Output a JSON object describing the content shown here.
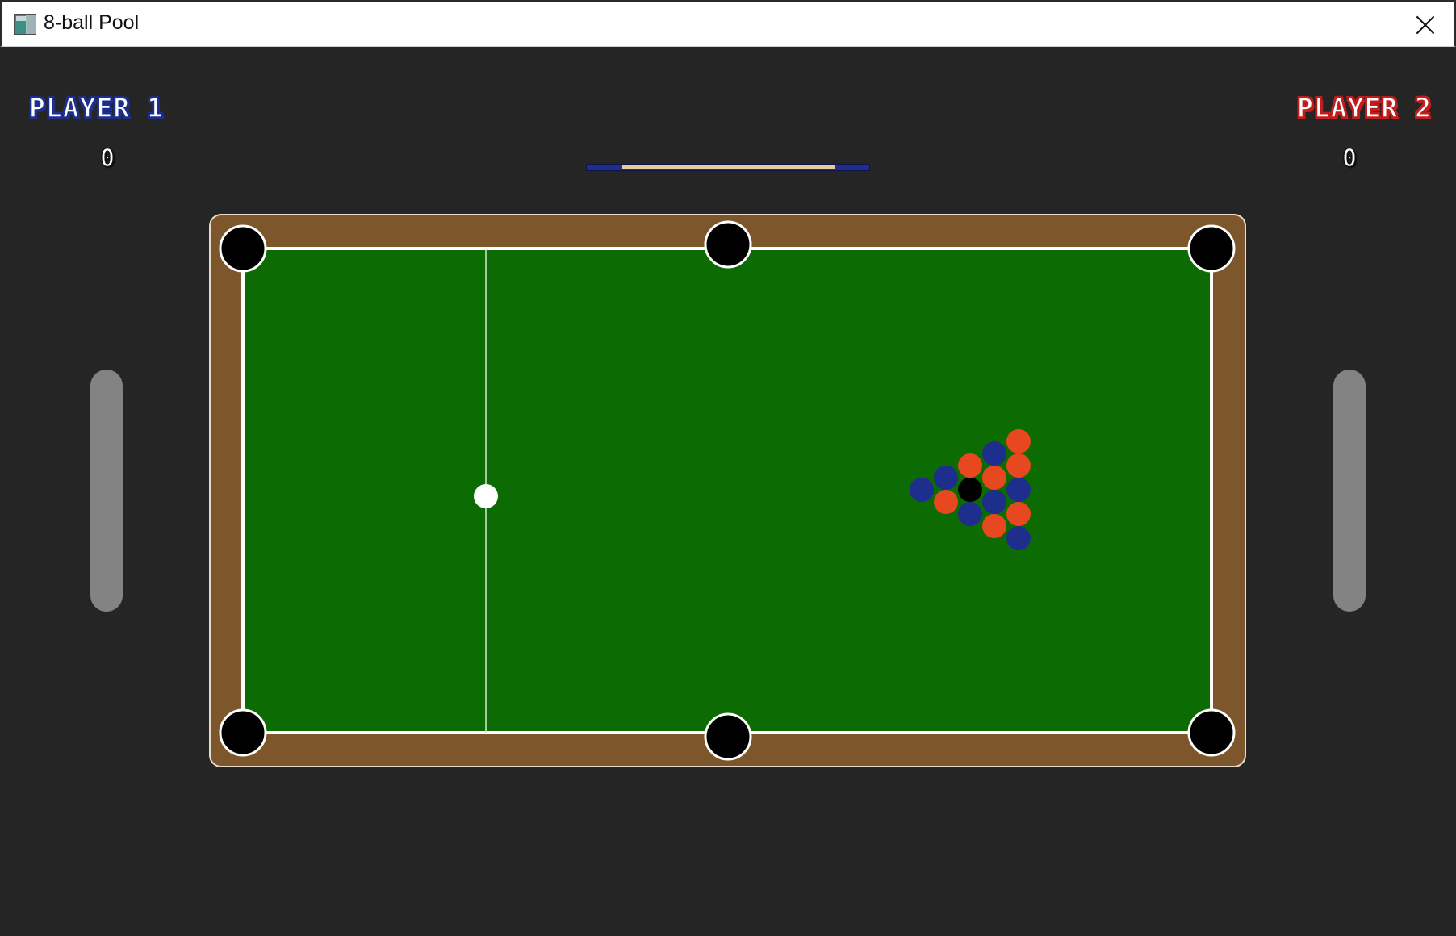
{
  "window": {
    "title": "8-ball Pool",
    "app_icon": "app-icon",
    "close_icon": "close-icon"
  },
  "players": [
    {
      "label": "PLAYER 1",
      "score": "0",
      "color": "#1e2e8c"
    },
    {
      "label": "PLAYER 2",
      "score": "0",
      "color": "#c21d1d"
    }
  ],
  "power_meter": {
    "level": 0.75,
    "bar_color": "#1f2d8c",
    "fill_color": "#e6cc9a"
  },
  "table": {
    "felt_color": "#0d6b03",
    "rail_color": "#7d562c",
    "pocket_color": "#000000",
    "pocket_count": 6
  },
  "balls": {
    "cue_ball": {
      "color": "#ffffff"
    },
    "eight_ball": {
      "color": "#000000"
    },
    "player1_color": "#1e2e8c",
    "player2_color": "#e84820",
    "rack": {
      "red": 7,
      "blue": 7,
      "black": 1
    }
  }
}
